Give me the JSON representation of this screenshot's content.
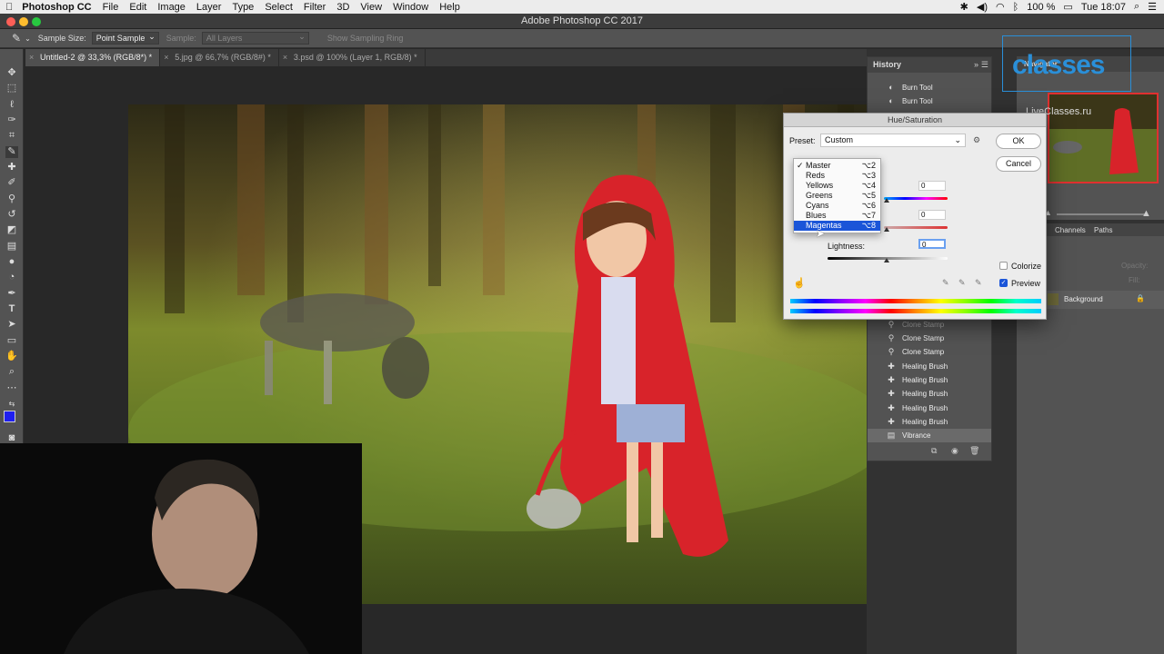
{
  "menubar": {
    "app_name": "Photoshop CC",
    "items": [
      "File",
      "Edit",
      "Image",
      "Layer",
      "Type",
      "Select",
      "Filter",
      "3D",
      "View",
      "Window",
      "Help"
    ],
    "battery": "100 %",
    "clock": "Tue 18:07"
  },
  "window": {
    "title": "Adobe Photoshop CC 2017"
  },
  "options_bar": {
    "sample_size_label": "Sample Size:",
    "sample_size_value": "Point Sample",
    "sample_label": "Sample:",
    "sample_value": "All Layers",
    "show_sampling_ring": "Show Sampling Ring"
  },
  "tabs": [
    {
      "label": "Untitled-2 @ 33,3% (RGB/8*) *",
      "active": true
    },
    {
      "label": "5.jpg @ 66,7% (RGB/8#) *",
      "active": false
    },
    {
      "label": "3.psd @ 100% (Layer 1, RGB/8) *",
      "active": false
    }
  ],
  "history": {
    "title": "History",
    "items_top": [
      "Burn Tool",
      "Burn Tool"
    ],
    "items_bottom": [
      "Clone Stamp",
      "Clone Stamp",
      "Clone Stamp",
      "Healing Brush",
      "Healing Brush",
      "Healing Brush",
      "Healing Brush",
      "Healing Brush",
      "Vibrance"
    ]
  },
  "navigator": {
    "title": "Navigator"
  },
  "layers_panel": {
    "tabs": [
      "Channels",
      "Paths"
    ],
    "opacity_label": "Opacity:",
    "fill_label": "Fill:",
    "layer_name": "Background"
  },
  "watermark": {
    "brand": "classes",
    "url": "LiveClasses.ru"
  },
  "dialog": {
    "title": "Hue/Saturation",
    "preset_label": "Preset:",
    "preset_value": "Custom",
    "ok": "OK",
    "cancel": "Cancel",
    "hue_value": "0",
    "saturation_value": "0",
    "lightness_label": "Lightness:",
    "lightness_value": "0",
    "colorize_label": "Colorize",
    "colorize_checked": false,
    "preview_label": "Preview",
    "preview_checked": true,
    "channels": [
      {
        "label": "Master",
        "shortcut": "⌥2",
        "checked": true
      },
      {
        "label": "Reds",
        "shortcut": "⌥3"
      },
      {
        "label": "Yellows",
        "shortcut": "⌥4"
      },
      {
        "label": "Greens",
        "shortcut": "⌥5"
      },
      {
        "label": "Cyans",
        "shortcut": "⌥6"
      },
      {
        "label": "Blues",
        "shortcut": "⌥7"
      },
      {
        "label": "Magentas",
        "shortcut": "⌥8",
        "highlighted": true
      }
    ]
  },
  "colors": {
    "accent_blue": "#1b55d8",
    "foreground_swatch": "#1f1ff0",
    "hood_red": "#d8232a"
  }
}
